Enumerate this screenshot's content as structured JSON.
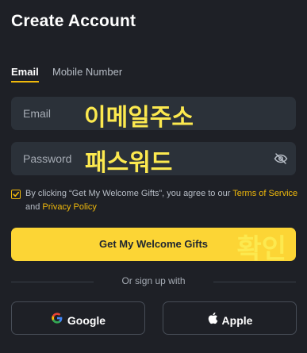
{
  "header": {
    "title": "Create Account"
  },
  "tabs": [
    {
      "label": "Email"
    },
    {
      "label": "Mobile Number"
    }
  ],
  "form": {
    "email": {
      "placeholder": "Email",
      "value": "",
      "overlay_label": "이메일주소"
    },
    "password": {
      "placeholder": "Password",
      "value": "",
      "overlay_label": "패스워드"
    },
    "consent": {
      "checked": true,
      "text_before": "By clicking “Get My Welcome Gifts”, you agree to our ",
      "terms_link": "Terms of Service",
      "and_text": "and ",
      "privacy_link": "Privacy Policy"
    },
    "submit": {
      "label": "Get My Welcome Gifts",
      "overlay_label": "확인"
    }
  },
  "divider": {
    "label": "Or sign up with"
  },
  "social": [
    {
      "label": "Google",
      "icon": "google-icon"
    },
    {
      "label": "Apple",
      "icon": "apple-icon"
    }
  ],
  "colors": {
    "background": "#1e2026",
    "input_bg": "#2b3139",
    "accent": "#f0b90b",
    "button": "#fcd535",
    "overlay_text": "#fce94f"
  }
}
